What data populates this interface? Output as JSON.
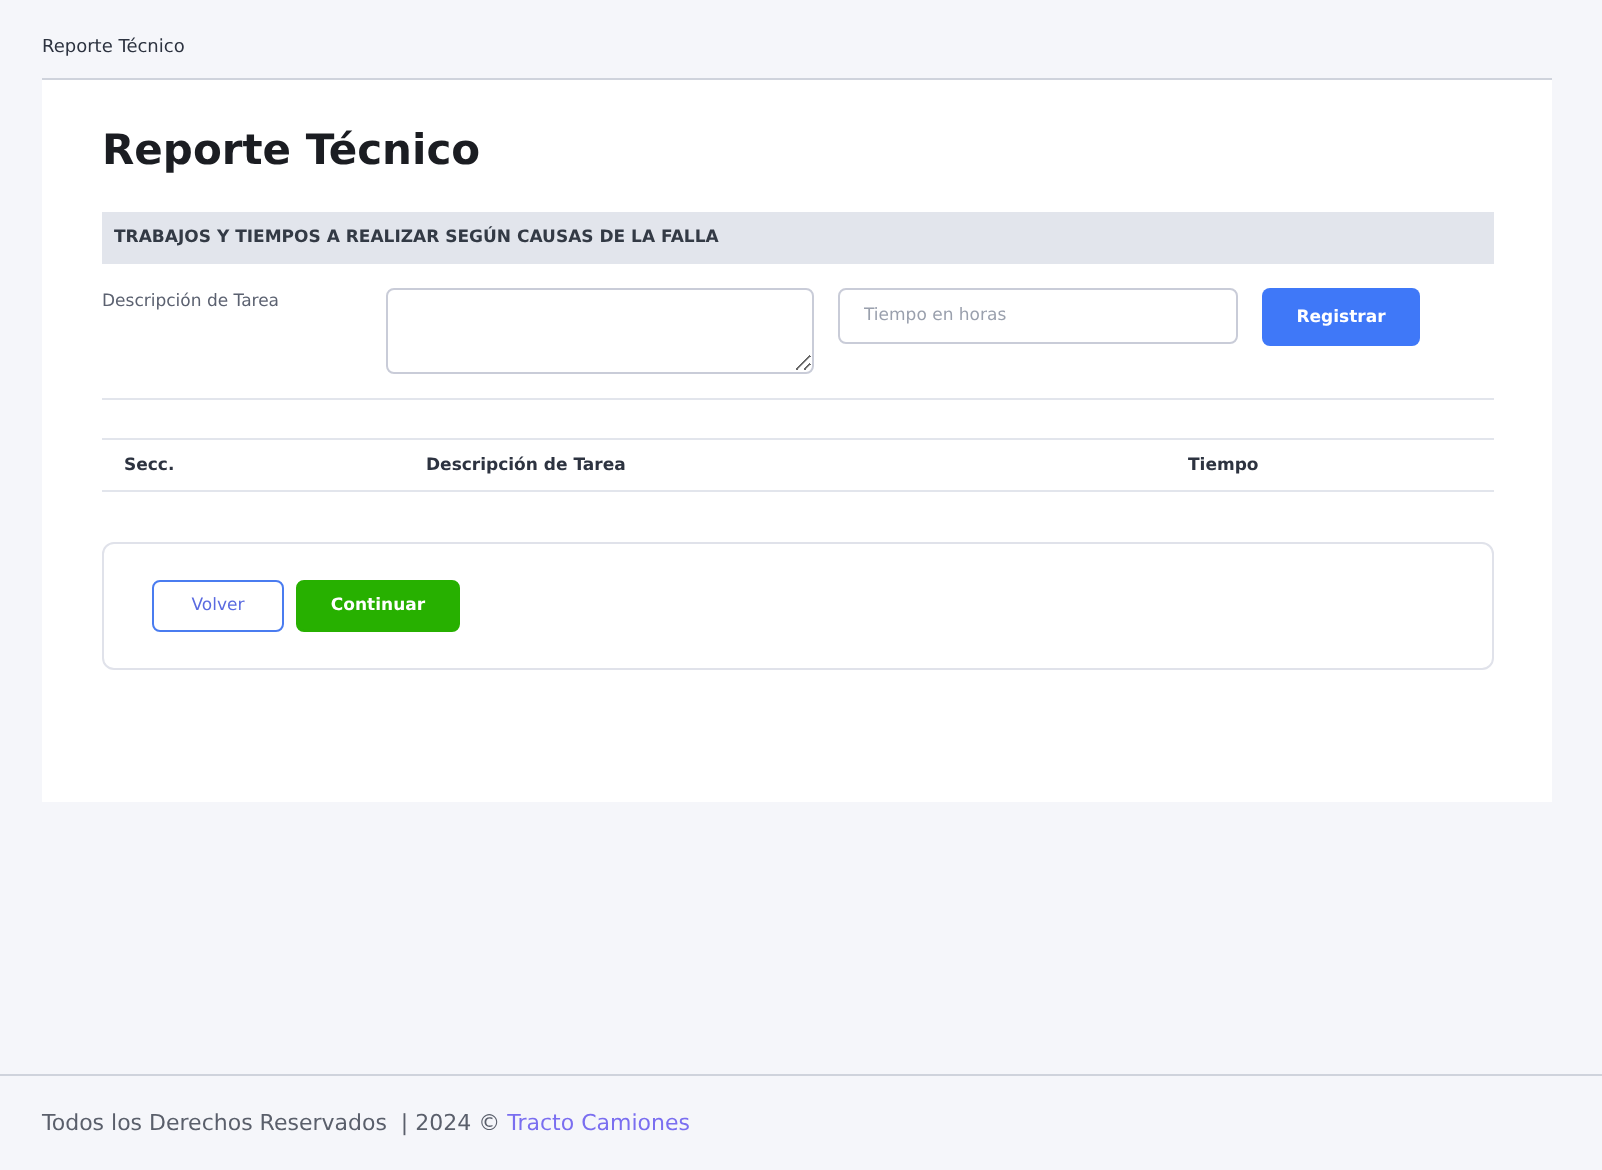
{
  "breadcrumb": "Reporte Técnico",
  "title": "Reporte Técnico",
  "section_header": "TRABAJOS Y TIEMPOS A REALIZAR SEGÚN CAUSAS DE LA FALLA",
  "form": {
    "label": "Descripción de Tarea",
    "hours_placeholder": "Tiempo en horas",
    "submit": "Registrar"
  },
  "table": {
    "columns": [
      "Secc.",
      "Descripción de Tarea",
      "Tiempo"
    ]
  },
  "actions": [
    {
      "label": "Volver",
      "kind": "outline"
    },
    {
      "label": "Continuar",
      "kind": "solid"
    }
  ],
  "footer": {
    "text": "Todos los Derechos Reservados  | 2024 © ",
    "link": "Tracto Camiones"
  }
}
